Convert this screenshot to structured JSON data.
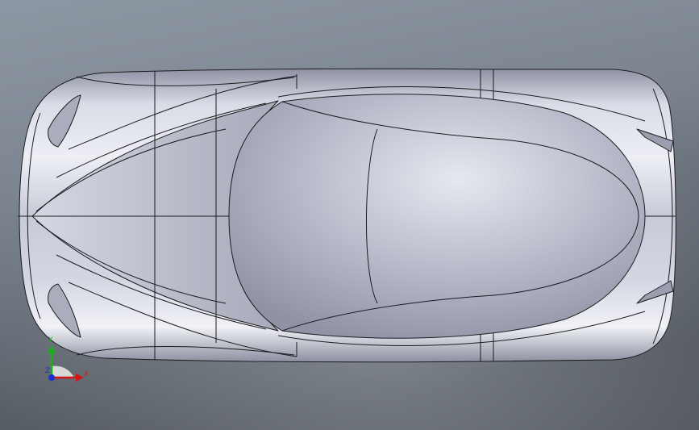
{
  "viewport": {
    "background_top": "#7d8793",
    "background_bottom": "#5b6068",
    "body_color": "#c9ccd8",
    "body_highlight": "#f2f3f8",
    "body_shadow": "#8f93a4",
    "edge_color": "#1a1a1a",
    "canopy_color": "#b4b8c6"
  },
  "triad": {
    "x_label": "X",
    "y_label": "Y",
    "z_label": "Z",
    "x_color": "#d01818",
    "y_color": "#18b018",
    "z_color": "#1c2fd0"
  }
}
